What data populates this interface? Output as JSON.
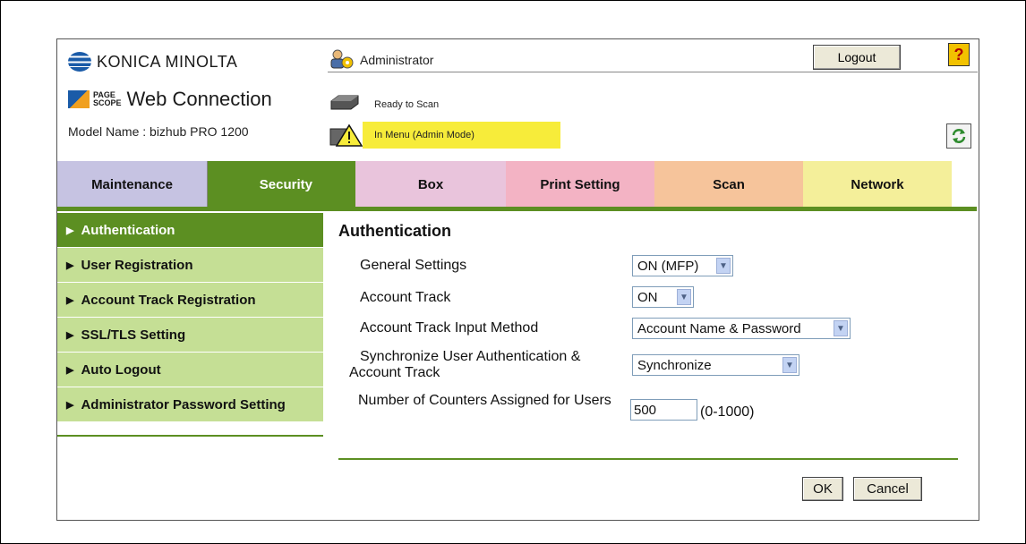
{
  "header": {
    "brand": "KONICA MINOLTA",
    "pagescope_line1": "PAGE",
    "pagescope_line2": "SCOPE",
    "web_connection": "Web Connection",
    "model": "Model Name : bizhub PRO 1200",
    "user": "Administrator",
    "logout_label": "Logout",
    "help_label": "?",
    "scanner_status": "Ready to Scan",
    "menu_status": "In Menu (Admin Mode)"
  },
  "tabs": [
    {
      "label": "Maintenance"
    },
    {
      "label": "Security"
    },
    {
      "label": "Box"
    },
    {
      "label": "Print Setting"
    },
    {
      "label": "Scan"
    },
    {
      "label": "Network"
    }
  ],
  "sidebar": {
    "items": [
      {
        "label": "Authentication"
      },
      {
        "label": "User Registration"
      },
      {
        "label": "Account Track Registration"
      },
      {
        "label": "SSL/TLS Setting"
      },
      {
        "label": "Auto Logout"
      },
      {
        "label": "Administrator Password Setting"
      }
    ]
  },
  "main": {
    "title": "Authentication",
    "fields": [
      {
        "label": "General Settings",
        "value": "ON (MFP)"
      },
      {
        "label": "Account Track",
        "value": "ON"
      },
      {
        "label": "Account Track Input Method",
        "value": "Account Name & Password"
      },
      {
        "label": "Synchronize User Authentication & Account Track",
        "value": "Synchronize"
      },
      {
        "label": "Number of Counters Assigned for Users",
        "value": "500",
        "range": "(0-1000)"
      }
    ],
    "ok_label": "OK",
    "cancel_label": "Cancel"
  },
  "colors": {
    "security_green": "#5c8f22",
    "sidebar_light": "#c5df95",
    "status_yellow": "#f7ec3a"
  }
}
